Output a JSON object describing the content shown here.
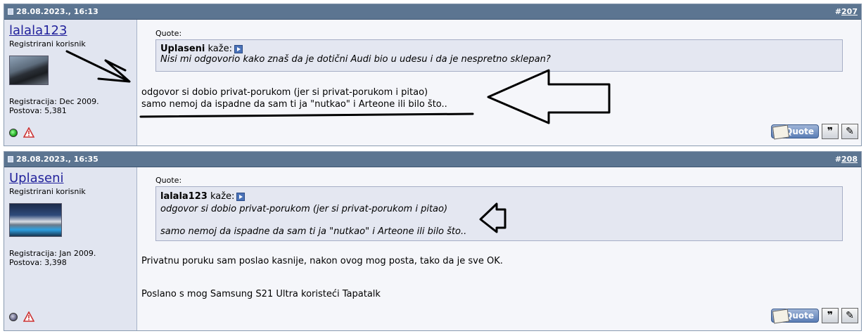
{
  "posts": [
    {
      "date": "28.08.2023., 16:13",
      "number_prefix": "#",
      "number": "207",
      "username": "lalala123",
      "user_title": "Registrirani korisnik",
      "registration": "Registracija: Dec 2009.",
      "posts_count": "Postova: 5,381",
      "online": true,
      "quote_label": "Quote:",
      "quote_author": "Uplaseni",
      "quote_says": "kaže:",
      "quote_lines": [
        "Nisi mi odgovorio kako znaš da je dotični Audi bio u udesu i da je nespretno sklepan?"
      ],
      "message_lines": [
        "odgovor si dobio privat-porukom (jer si privat-porukom i pitao)",
        "samo nemoj da ispadne da sam ti ja \"nutkao\" i Arteone ili bilo što.."
      ],
      "quote_button": "Quote"
    },
    {
      "date": "28.08.2023., 16:35",
      "number_prefix": "#",
      "number": "208",
      "username": "Uplaseni",
      "user_title": "Registrirani korisnik",
      "registration": "Registracija: Jan 2009.",
      "posts_count": "Postova: 3,398",
      "online": false,
      "quote_label": "Quote:",
      "quote_author": "lalala123",
      "quote_says": "kaže:",
      "quote_lines": [
        "odgovor si dobio privat-porukom (jer si privat-porukom i pitao)",
        "samo nemoj da ispadne da sam ti ja \"nutkao\" i Arteone ili bilo što.."
      ],
      "message_lines": [
        "Privatnu poruku sam poslao kasnije, nakon ovog mog posta, tako da je sve OK.",
        "Poslano s mog Samsung S21 Ultra koristeći Tapatalk"
      ],
      "quote_button": "Quote"
    }
  ],
  "colors": {
    "header": "#5c7591",
    "sidebar": "#e1e5f0",
    "quote_bg": "#e4e7f1",
    "username": "#22229c"
  },
  "icons": {
    "post": "document-icon",
    "goto": "go-to-post-icon",
    "online": "online-status-icon",
    "offline": "offline-status-icon",
    "report": "report-icon",
    "multiquote": "multiquote-icon",
    "reply": "quick-reply-icon"
  }
}
